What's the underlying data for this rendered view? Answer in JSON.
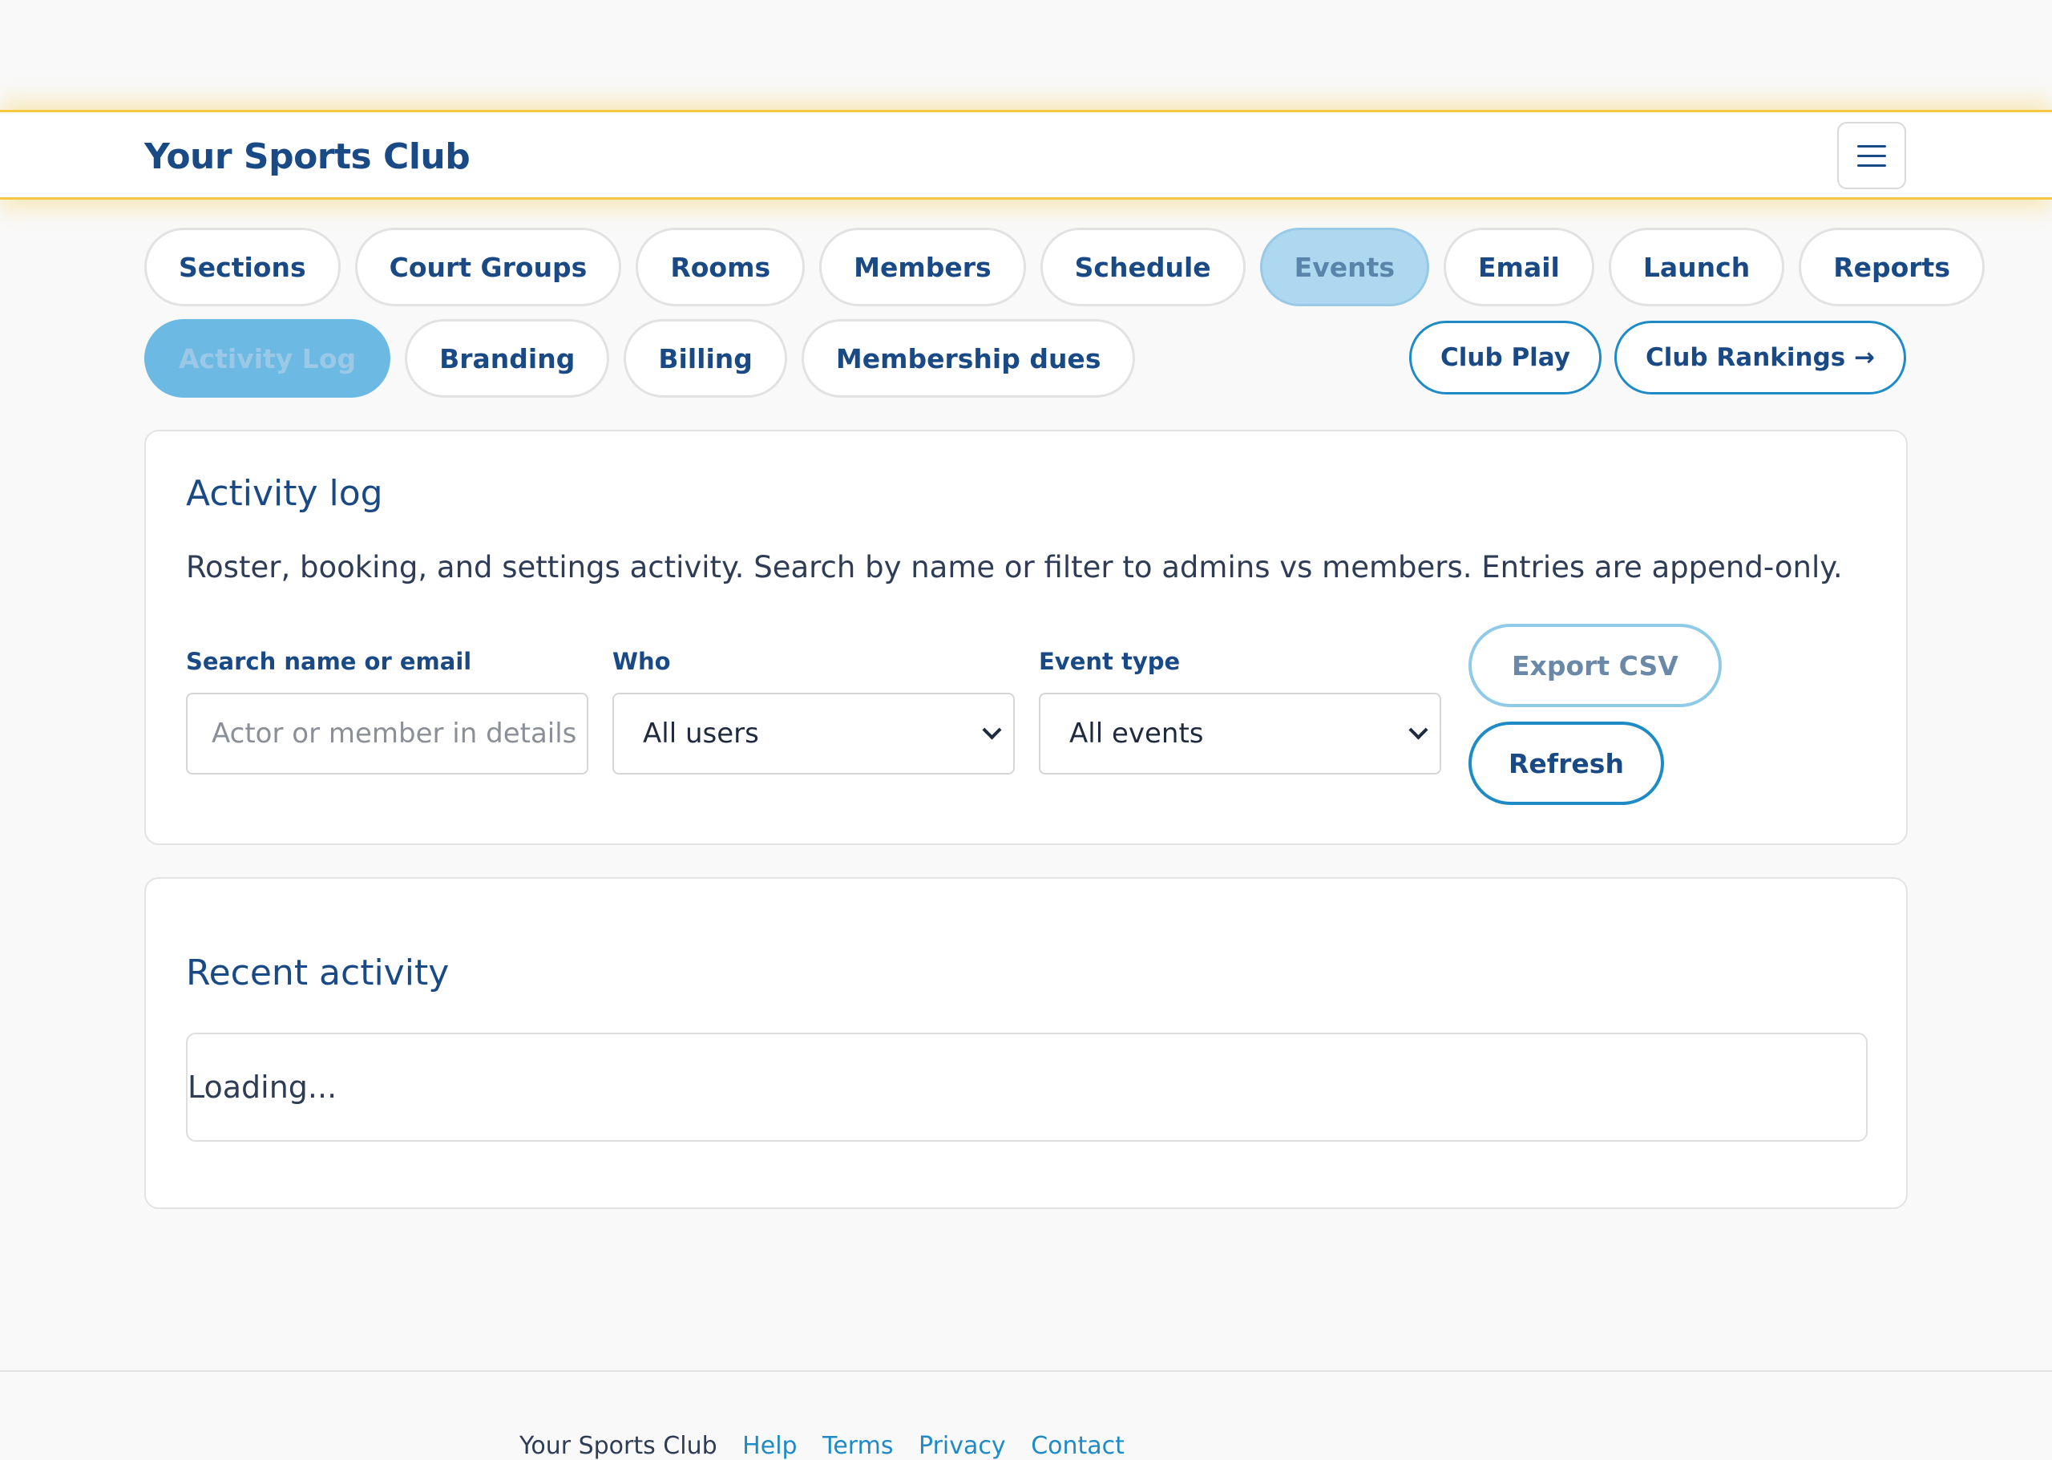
{
  "brand": {
    "name": "Your Sports Club"
  },
  "header": {
    "menu_icon": "hamburger-icon"
  },
  "nav": {
    "row1": [
      "Sections",
      "Court Groups",
      "Rooms",
      "Members",
      "Schedule",
      "Events",
      "Email",
      "Launch",
      "Reports"
    ],
    "row2": [
      "Activity Log",
      "Branding",
      "Billing",
      "Membership dues"
    ],
    "active": "Activity Log"
  },
  "external_links": [
    {
      "label": "Club Play"
    },
    {
      "label": "Club Rankings →"
    }
  ],
  "activity": {
    "title": "Activity log",
    "description": "Roster, booking, and settings activity. Search by name or filter to admins vs members. Entries are append-only.",
    "search": {
      "label": "Search name or email",
      "placeholder": "Actor or member in details"
    },
    "who": {
      "label": "Who",
      "selected": "All users"
    },
    "event_type": {
      "label": "Event type",
      "selected": "All events"
    },
    "export_label": "Export CSV",
    "refresh_label": "Refresh"
  },
  "recent": {
    "title": "Recent activity",
    "status": "Loading..."
  },
  "footer": {
    "brand": "Your Sports Club",
    "links": [
      "Help",
      "Terms",
      "Privacy",
      "Contact"
    ]
  }
}
